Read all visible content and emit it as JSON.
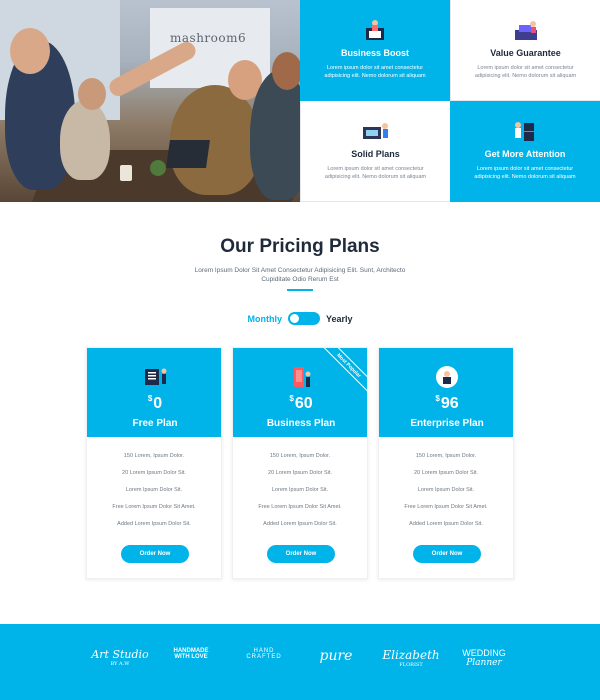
{
  "hero": {
    "photo_sign": "mashroom6",
    "features": [
      {
        "title": "Business Boost",
        "desc": "Lorem ipsum dolor sit amet consectetur adipisicing elit. Nemo dolorum sit aliquam",
        "theme": "blue",
        "icon": "person-at-laptop-icon"
      },
      {
        "title": "Value Guarantee",
        "desc": "Lorem ipsum dolor sit amet consectetur adipisicing elit. Nemo dolorum sit aliquam",
        "theme": "white",
        "icon": "person-at-desk-icon"
      },
      {
        "title": "Solid Plans",
        "desc": "Lorem ipsum dolor sit amet consectetur adipisicing elit. Nemo dolorum sit aliquam",
        "theme": "white",
        "icon": "person-presenting-board-icon"
      },
      {
        "title": "Get More Attention",
        "desc": "Lorem ipsum dolor sit amet consectetur adipisicing elit. Nemo dolorum sit aliquam",
        "theme": "blue",
        "icon": "person-with-boxes-icon"
      }
    ]
  },
  "pricing": {
    "title": "Our Pricing Plans",
    "subtitle": "Lorem Ipsum Dolor Sit Amet Consectetur Adipisicing Elit. Sunt, Architecto Cupiditate Odio Rerum Est",
    "toggle": {
      "monthly": "Monthly",
      "yearly": "Yearly",
      "selected": "Monthly"
    },
    "plans": [
      {
        "currency": "$",
        "price": "0",
        "name": "Free Plan",
        "icon": "person-at-board-icon",
        "badge": "",
        "features": [
          "150 Lorem, Ipsum Dolor.",
          "20 Lorem Ipsum Dolor Sit.",
          "Lorem Ipsum Dolor Sit.",
          "Free Lorem Ipsum Dolor Sit Amet.",
          "Added Lorem Ipsum Dolor Sit."
        ],
        "button": "Order Now"
      },
      {
        "currency": "$",
        "price": "60",
        "name": "Business Plan",
        "icon": "person-with-phone-icon",
        "badge": "Most Popular",
        "features": [
          "150 Lorem, Ipsum Dolor.",
          "20 Lorem Ipsum Dolor Sit.",
          "Lorem Ipsum Dolor Sit.",
          "Free Lorem Ipsum Dolor Sit Amet.",
          "Added Lorem Ipsum Dolor Sit."
        ],
        "button": "Order Now"
      },
      {
        "currency": "$",
        "price": "96",
        "name": "Enterprise Plan",
        "icon": "person-in-circle-icon",
        "badge": "",
        "features": [
          "150 Lorem, Ipsum Dolor.",
          "20 Lorem Ipsum Dolor Sit.",
          "Lorem Ipsum Dolor Sit.",
          "Free Lorem Ipsum Dolor Sit Amet.",
          "Added Lorem Ipsum Dolor Sit."
        ],
        "button": "Order Now"
      }
    ]
  },
  "logos": {
    "items": [
      {
        "line1": "Art Studio",
        "line2": "BY A.W"
      },
      {
        "line1": "HANDMADE",
        "line2": "WITH LOVE"
      },
      {
        "line1": "HAND",
        "line2": "CRAFTED"
      },
      {
        "line1": "pure",
        "line2": ""
      },
      {
        "line1": "Elizabeth",
        "line2": "FLORIST"
      },
      {
        "line1": "WEDDING",
        "line2": "Planner"
      }
    ]
  },
  "colors": {
    "accent": "#00b4ea",
    "text_dark": "#1f2a3a"
  }
}
